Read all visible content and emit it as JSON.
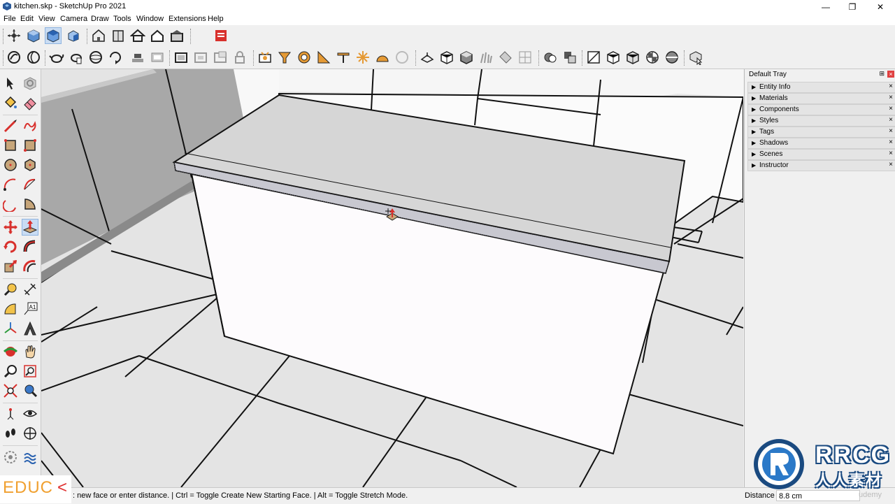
{
  "window": {
    "title": "kitchen.skp - SketchUp Pro 2021",
    "app_icon": "sketchup-logo-icon",
    "minimize": "—",
    "restore": "❐",
    "close": "✕"
  },
  "menu": [
    "File",
    "Edit",
    "View",
    "Camera",
    "Draw",
    "Tools",
    "Window",
    "Extensions",
    "Help"
  ],
  "tray": {
    "title": "Default Tray",
    "pin": "⊞",
    "close": "×",
    "panels": [
      {
        "label": "Entity Info",
        "arrow": "▶",
        "close": "×"
      },
      {
        "label": "Materials",
        "arrow": "▶",
        "close": "×"
      },
      {
        "label": "Components",
        "arrow": "▶",
        "close": "×"
      },
      {
        "label": "Styles",
        "arrow": "▶",
        "close": "×"
      },
      {
        "label": "Tags",
        "arrow": "▶",
        "close": "×"
      },
      {
        "label": "Shadows",
        "arrow": "▶",
        "close": "×"
      },
      {
        "label": "Scenes",
        "arrow": "▶",
        "close": "×"
      },
      {
        "label": "Instructor",
        "arrow": "▶",
        "close": "×"
      }
    ]
  },
  "statusbar": {
    "message": ": new face or enter distance. | Ctrl = Toggle Create New Starting Face. | Alt = Toggle Stretch Mode.",
    "distance_label": "Distance",
    "distance_value": "8.8 cm",
    "watermark": "udemy"
  },
  "watermarks": {
    "educ": "EDUC",
    "educ_chevron": "<",
    "rrcg": "RRCG",
    "rrcg_sub": "人人素材"
  },
  "colors": {
    "accent_active": "#c9dcf3",
    "sketchup_red": "#d8302c",
    "tool_blue": "#3a78c8",
    "tool_orange": "#e59a35"
  },
  "toolbar_icons_row1": [
    "orbit-icon",
    "iso-view-icon",
    "top-view-icon",
    "front-view-icon",
    "right-view-icon",
    "back-view-icon",
    "left-view-icon",
    "house-icon",
    "house-outline-icon",
    "house-roof-icon",
    "house-front-icon",
    "extension-warehouse-icon"
  ],
  "toolbar_icons_row2": [
    "select-icon",
    "eraser-icon",
    "bucket-icon",
    "push-pull-icon",
    "follow-me-icon",
    "offset-icon",
    "move-icon",
    "rotate-icon",
    "scale-icon",
    "section-icon",
    "group-icon",
    "component-icon",
    "lock-icon"
  ],
  "left_tools": [
    "select-icon",
    "make-component-icon",
    "paint-bucket-icon",
    "eraser-icon",
    "line-icon",
    "freehand-icon",
    "rectangle-icon",
    "rotated-rectangle-icon",
    "circle-icon",
    "polygon-icon",
    "arc-icon",
    "two-point-arc-icon",
    "three-point-arc-icon",
    "pie-icon",
    "move-icon",
    "push-pull-icon",
    "rotate-icon",
    "follow-me-icon",
    "scale-icon",
    "offset-icon",
    "tape-measure-icon",
    "dimension-icon",
    "protractor-icon",
    "text-icon",
    "axes-icon",
    "3d-text-icon",
    "orbit-icon",
    "pan-icon",
    "zoom-icon",
    "zoom-window-icon",
    "zoom-extents-icon",
    "previous-view-icon",
    "position-camera-icon",
    "look-around-icon",
    "walk-icon",
    "section-plane-icon",
    "sandbox-icon",
    "smoove-icon"
  ]
}
